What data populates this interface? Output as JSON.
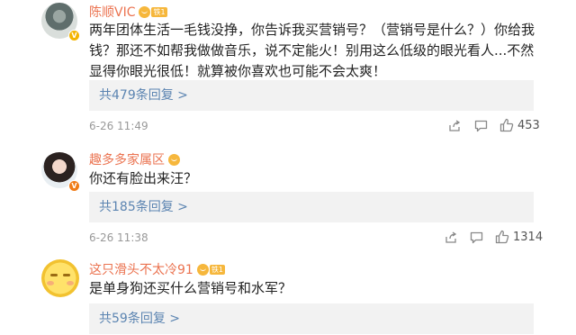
{
  "comments": [
    {
      "name": "陈顺VIC",
      "fan_label": "铁1",
      "text": "两年团体生活一毛钱没挣，你告诉我买营销号？（营销号是什么？）你给我钱？那还不如帮我做做音乐，说不定能火！别用这么低级的眼光看人...不然显得你眼光很低！就算被你喜欢也可能不会太爽！",
      "replies": "共479条回复 >",
      "time": "6-26 11:49",
      "likes": "453"
    },
    {
      "name": "趣多多家属区",
      "text": "你还有脸出来汪？",
      "replies": "共185条回复 >",
      "time": "6-26 11:38",
      "likes": "1314"
    },
    {
      "name": "这只滑头不太冷91",
      "fan_label": "铁1",
      "text": "是单身狗还买什么营销号和水军？",
      "replies": "共59条回复 >"
    }
  ],
  "colors": {
    "name": "#eb7350",
    "link": "#5b84b1",
    "meta": "#999999",
    "reply_bg": "#f2f2f2"
  },
  "icons": {
    "share": "share-icon",
    "comment": "comment-icon",
    "like": "thumbs-up-icon"
  }
}
